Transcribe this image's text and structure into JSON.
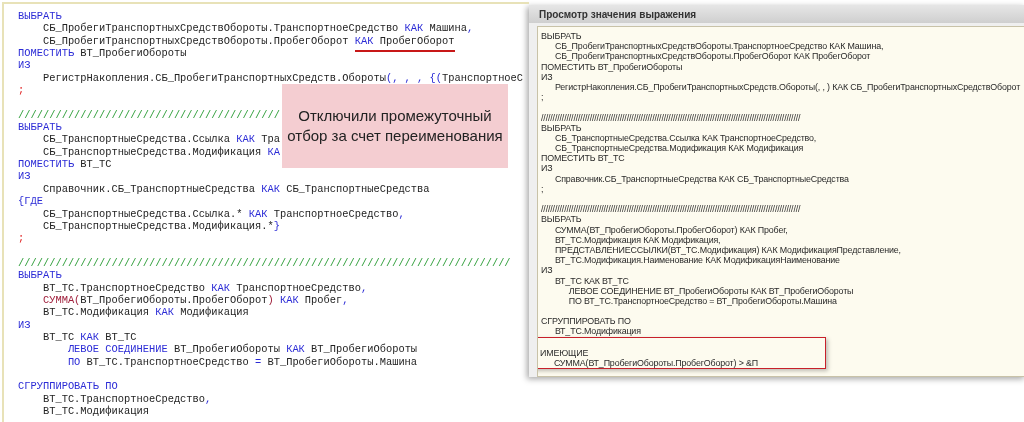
{
  "editor": {
    "lines": [
      {
        "tokens": [
          {
            "kind": "kw",
            "text": "ВЫБРАТЬ"
          }
        ]
      },
      {
        "tokens": [
          {
            "kind": "plain",
            "text": "    СБ_ПробегиТранспортныхСредствОбороты.ТранспортноеСредство "
          },
          {
            "kind": "kw",
            "text": "КАК"
          },
          {
            "kind": "plain",
            "text": " Машина"
          },
          {
            "kind": "op",
            "text": ","
          }
        ]
      },
      {
        "tokens": [
          {
            "kind": "plain",
            "text": "    СБ_ПробегиТранспортныхСредствОбороты.ПробегОборот "
          },
          {
            "kind": "kw",
            "text": "КАК",
            "underlined": true
          },
          {
            "kind": "plain",
            "text": " ПробегОборот",
            "underlined": true
          }
        ]
      },
      {
        "tokens": [
          {
            "kind": "kw",
            "text": "ПОМЕСТИТЬ"
          },
          {
            "kind": "plain",
            "text": " ВТ_ПробегиОбороты"
          }
        ]
      },
      {
        "tokens": [
          {
            "kind": "kw",
            "text": "ИЗ"
          }
        ]
      },
      {
        "tokens": [
          {
            "kind": "plain",
            "text": "    РегистрНакопления.СБ_ПробегиТранспортныхСредств.Обороты"
          },
          {
            "kind": "op",
            "text": "(, , , {("
          },
          {
            "kind": "plain",
            "text": "ТранспортноеС"
          }
        ]
      },
      {
        "tokens": [
          {
            "kind": "err",
            "text": ";"
          }
        ]
      },
      {
        "kind": "blank"
      },
      {
        "tokens": [
          {
            "kind": "cm",
            "text": "//////////////////////////////////////////"
          }
        ]
      },
      {
        "tokens": [
          {
            "kind": "kw",
            "text": "ВЫБРАТЬ"
          }
        ]
      },
      {
        "tokens": [
          {
            "kind": "plain",
            "text": "    СБ_ТранспортныеСредства.Ссылка "
          },
          {
            "kind": "kw",
            "text": "КАК"
          },
          {
            "kind": "plain",
            "text": " Тра"
          }
        ]
      },
      {
        "tokens": [
          {
            "kind": "plain",
            "text": "    СБ_ТранспортныеСредства.Модификация "
          },
          {
            "kind": "kw",
            "text": "КА"
          }
        ]
      },
      {
        "tokens": [
          {
            "kind": "kw",
            "text": "ПОМЕСТИТЬ"
          },
          {
            "kind": "plain",
            "text": " ВТ_ТС"
          }
        ]
      },
      {
        "tokens": [
          {
            "kind": "kw",
            "text": "ИЗ"
          }
        ]
      },
      {
        "tokens": [
          {
            "kind": "plain",
            "text": "    Справочник.СБ_ТранспортныеСредства "
          },
          {
            "kind": "kw",
            "text": "КАК"
          },
          {
            "kind": "plain",
            "text": " СБ_ТранспортныеСредства"
          }
        ]
      },
      {
        "tokens": [
          {
            "kind": "op",
            "text": "{"
          },
          {
            "kind": "kw",
            "text": "ГДЕ"
          }
        ]
      },
      {
        "tokens": [
          {
            "kind": "plain",
            "text": "    СБ_ТранспортныеСредства.Ссылка.* "
          },
          {
            "kind": "kw",
            "text": "КАК"
          },
          {
            "kind": "plain",
            "text": " ТранспортноеСредство"
          },
          {
            "kind": "op",
            "text": ","
          }
        ]
      },
      {
        "tokens": [
          {
            "kind": "plain",
            "text": "    СБ_ТранспортныеСредства.Модификация.*"
          },
          {
            "kind": "op",
            "text": "}"
          }
        ]
      },
      {
        "tokens": [
          {
            "kind": "err",
            "text": ";"
          }
        ]
      },
      {
        "kind": "blank"
      },
      {
        "tokens": [
          {
            "kind": "cm",
            "text": "///////////////////////////////////////////////////////////////////////////////"
          }
        ]
      },
      {
        "tokens": [
          {
            "kind": "kw",
            "text": "ВЫБРАТЬ"
          }
        ]
      },
      {
        "tokens": [
          {
            "kind": "plain",
            "text": "    ВТ_ТС.ТранспортноеСредство "
          },
          {
            "kind": "kw",
            "text": "КАК"
          },
          {
            "kind": "plain",
            "text": " ТранспортноеСредство"
          },
          {
            "kind": "op",
            "text": ","
          }
        ]
      },
      {
        "tokens": [
          {
            "kind": "fn",
            "text": "    СУММА("
          },
          {
            "kind": "plain",
            "text": "ВТ_ПробегиОбороты.ПробегОборот"
          },
          {
            "kind": "fn",
            "text": ")"
          },
          {
            "kind": "kw",
            "text": " КАК"
          },
          {
            "kind": "plain",
            "text": " Пробег"
          },
          {
            "kind": "op",
            "text": ","
          }
        ]
      },
      {
        "tokens": [
          {
            "kind": "plain",
            "text": "    ВТ_ТС.Модификация "
          },
          {
            "kind": "kw",
            "text": "КАК"
          },
          {
            "kind": "plain",
            "text": " Модификация"
          }
        ]
      },
      {
        "tokens": [
          {
            "kind": "kw",
            "text": "ИЗ"
          }
        ]
      },
      {
        "tokens": [
          {
            "kind": "plain",
            "text": "    ВТ_ТС "
          },
          {
            "kind": "kw",
            "text": "КАК"
          },
          {
            "kind": "plain",
            "text": " ВТ_ТС"
          }
        ]
      },
      {
        "tokens": [
          {
            "kind": "kw",
            "text": "        ЛЕВОЕ СОЕДИНЕНИЕ"
          },
          {
            "kind": "plain",
            "text": " ВТ_ПробегиОбороты "
          },
          {
            "kind": "kw",
            "text": "КАК"
          },
          {
            "kind": "plain",
            "text": " ВТ_ПробегиОбороты"
          }
        ]
      },
      {
        "tokens": [
          {
            "kind": "kw",
            "text": "        ПО"
          },
          {
            "kind": "plain",
            "text": " ВТ_ТС.ТранспортноеСредство "
          },
          {
            "kind": "op",
            "text": "="
          },
          {
            "kind": "plain",
            "text": " ВТ_ПробегиОбороты.Машина"
          }
        ]
      },
      {
        "kind": "blank"
      },
      {
        "tokens": [
          {
            "kind": "kw",
            "text": "СГРУППИРОВАТЬ ПО"
          }
        ]
      },
      {
        "tokens": [
          {
            "kind": "plain",
            "text": "    ВТ_ТС.ТранспортноеСредство"
          },
          {
            "kind": "op",
            "text": ","
          }
        ]
      },
      {
        "tokens": [
          {
            "kind": "plain",
            "text": "    ВТ_ТС.Модификация"
          }
        ]
      }
    ]
  },
  "callout": {
    "text": "Отключили промежуточный отбор за счет переименования"
  },
  "window": {
    "title": "Просмотр значения выражения",
    "lines": [
      {
        "text": "ВЫБРАТЬ",
        "highlighted": false
      },
      {
        "text": "      СБ_ПробегиТранспортныхСредствОбороты.ТранспортноеСредство КАК Машина,",
        "highlighted": false
      },
      {
        "text": "      СБ_ПробегиТранспортныхСредствОбороты.ПробегОборот КАК ПробегОборот",
        "highlighted": false
      },
      {
        "text": "ПОМЕСТИТЬ ВТ_ПробегиОбороты",
        "highlighted": false
      },
      {
        "text": "ИЗ",
        "highlighted": false
      },
      {
        "text": "      РегистрНакопления.СБ_ПробегиТранспортныхСредств.Обороты(, , ) КАК СБ_ПробегиТранспортныхСредствОборот",
        "highlighted": false
      },
      {
        "text": ";",
        "highlighted": false
      },
      {
        "kind": "blank",
        "highlighted": false
      },
      {
        "text": "////////////////////////////////////////////////////////////////////////////////////////////////////////////////",
        "highlighted": false
      },
      {
        "text": "ВЫБРАТЬ",
        "highlighted": false
      },
      {
        "text": "      СБ_ТранспортныеСредства.Ссылка КАК ТранспортноеСредство,",
        "highlighted": false
      },
      {
        "text": "      СБ_ТранспортныеСредства.Модификация КАК Модификация",
        "highlighted": false
      },
      {
        "text": "ПОМЕСТИТЬ ВТ_ТС",
        "highlighted": false
      },
      {
        "text": "ИЗ",
        "highlighted": false
      },
      {
        "text": "      Справочник.СБ_ТранспортныеСредства КАК СБ_ТранспортныеСредства",
        "highlighted": false
      },
      {
        "text": ";",
        "highlighted": false
      },
      {
        "kind": "blank",
        "highlighted": false
      },
      {
        "text": "////////////////////////////////////////////////////////////////////////////////////////////////////////////////",
        "highlighted": false
      },
      {
        "text": "ВЫБРАТЬ",
        "highlighted": false
      },
      {
        "text": "      СУММА(ВТ_ПробегиОбороты.ПробегОборот) КАК Пробег,",
        "highlighted": false
      },
      {
        "text": "      ВТ_ТС.Модификация КАК Модификация,",
        "highlighted": false
      },
      {
        "text": "      ПРЕДСТАВЛЕНИЕССЫЛКИ(ВТ_ТС.Модификация) КАК МодификацияПредставление,",
        "highlighted": false
      },
      {
        "text": "      ВТ_ТС.Модификация.Наименование КАК МодификацияНаименование",
        "highlighted": false
      },
      {
        "text": "ИЗ",
        "highlighted": false
      },
      {
        "text": "      ВТ_ТС КАК ВТ_ТС",
        "highlighted": false
      },
      {
        "text": "            ЛЕВОЕ СОЕДИНЕНИЕ ВТ_ПробегиОбороты КАК ВТ_ПробегиОбороты",
        "highlighted": false
      },
      {
        "text": "            ПО ВТ_ТС.ТранспортноеСредство = ВТ_ПробегиОбороты.Машина",
        "highlighted": false
      },
      {
        "kind": "blank",
        "highlighted": false
      },
      {
        "text": "СГРУППИРОВАТЬ ПО",
        "highlighted": false
      },
      {
        "text": "      ВТ_ТС.Модификация",
        "highlighted": false
      },
      {
        "kind": "blank",
        "highlighted": true
      },
      {
        "text": "ИМЕЮЩИЕ",
        "highlighted": true
      },
      {
        "text": "      СУММА(ВТ_ПробегиОбороты.ПробегОборот) > &П",
        "highlighted": true
      }
    ]
  }
}
